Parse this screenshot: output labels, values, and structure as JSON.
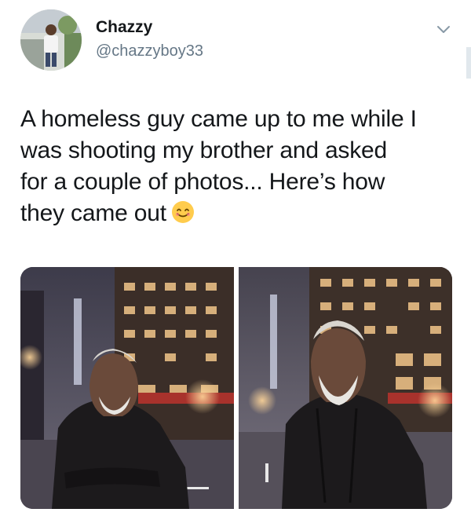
{
  "tweet": {
    "author": {
      "display_name": "Chazzy",
      "handle": "@chazzyboy33",
      "avatar": "avatar-photo"
    },
    "menu_icon": "chevron-down-icon",
    "text_lines": [
      "A homeless guy came up to me while I",
      "was shooting my brother and asked",
      "for a couple of photos... Here’s how",
      "they came out"
    ],
    "emoji": "smiling-face-icon",
    "media": [
      {
        "name": "photo-1"
      },
      {
        "name": "photo-2"
      }
    ]
  },
  "colors": {
    "text": "#14171a",
    "secondary_text": "#657786",
    "emoji_face": "#ffcc4d"
  }
}
